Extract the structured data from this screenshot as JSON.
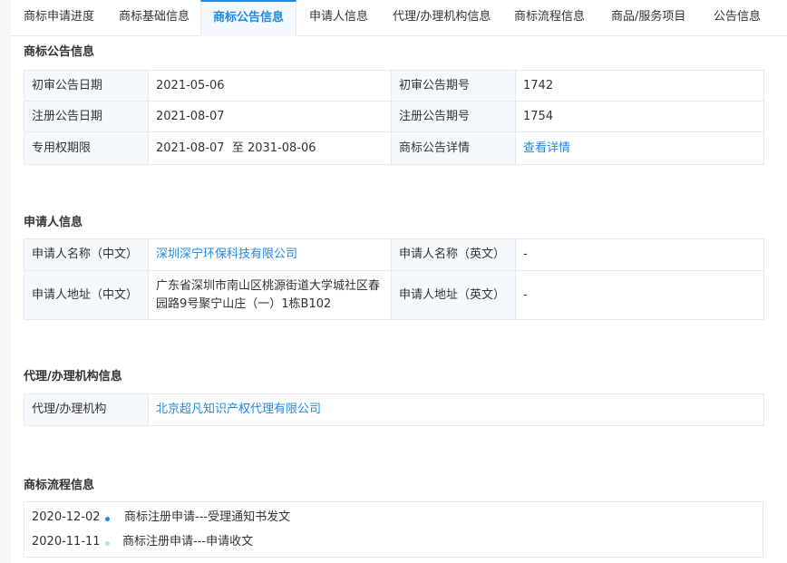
{
  "tabs": [
    {
      "label": "商标申请进度"
    },
    {
      "label": "商标基础信息"
    },
    {
      "label": "商标公告信息"
    },
    {
      "label": "申请人信息"
    },
    {
      "label": "代理/办理机构信息"
    },
    {
      "label": "商标流程信息"
    },
    {
      "label": "商品/服务项目"
    },
    {
      "label": "公告信息"
    }
  ],
  "notice": {
    "title": "商标公告信息",
    "prelim_date_label": "初审公告日期",
    "prelim_date": "2021-05-06",
    "prelim_no_label": "初审公告期号",
    "prelim_no": "1742",
    "reg_date_label": "注册公告日期",
    "reg_date": "2021-08-07",
    "reg_no_label": "注册公告期号",
    "reg_no": "1754",
    "term_label": "专用权期限",
    "term": "2021-08-07  至 2031-08-06",
    "detail_label": "商标公告详情",
    "detail_link": "查看详情"
  },
  "applicant": {
    "title": "申请人信息",
    "name_cn_label": "申请人名称（中文）",
    "name_cn": "深圳深宁环保科技有限公司",
    "name_en_label": "申请人名称（英文）",
    "name_en": "-",
    "addr_cn_label": "申请人地址（中文）",
    "addr_cn_line1": "广东省深圳市南山区桃源街道大学城社区春",
    "addr_cn_line2": "园路9号聚宁山庄（一）1栋B102",
    "addr_en_label": "申请人地址（英文）",
    "addr_en": "-"
  },
  "agency": {
    "title": "代理/办理机构信息",
    "label": "代理/办理机构",
    "name": "北京超凡知识产权代理有限公司"
  },
  "flow": {
    "title": "商标流程信息",
    "items": [
      {
        "date": "2020-12-02",
        "text": "商标注册申请---受理通知书发文",
        "dot_color": "#1e88e5"
      },
      {
        "date": "2020-11-11",
        "text": "商标注册申请---申请收文",
        "dot_color": "#b9dcf7"
      }
    ]
  }
}
